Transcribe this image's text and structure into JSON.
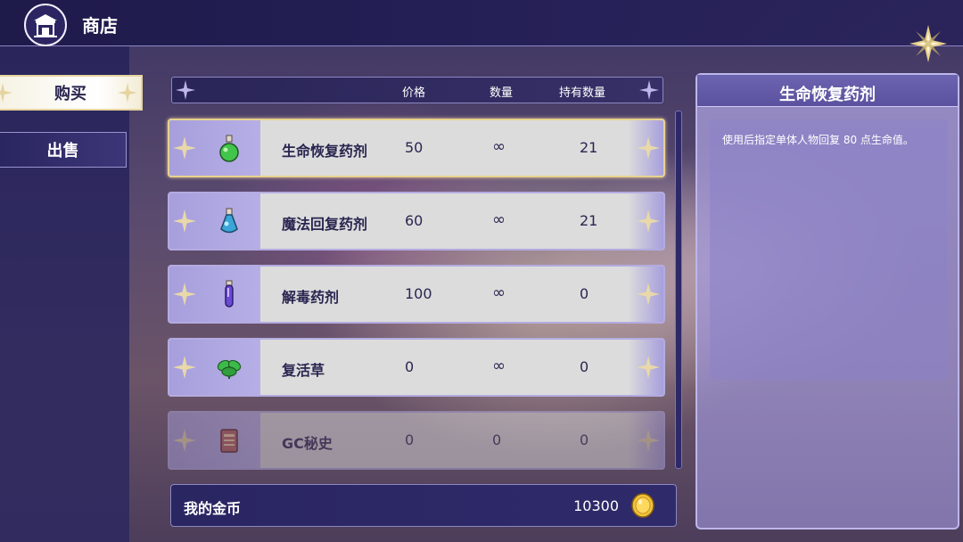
{
  "header": {
    "title": "商店",
    "logo_icon": "shop-icon",
    "corner_icon": "star-ornament-icon"
  },
  "sidebar": {
    "tabs": [
      {
        "label": "购买",
        "active": true
      },
      {
        "label": "出售",
        "active": false
      }
    ]
  },
  "table": {
    "columns": {
      "price": "价格",
      "quantity": "数量",
      "owned": "持有数量"
    },
    "rows": [
      {
        "name": "生命恢复药剂",
        "price": "50",
        "quantity": "∞",
        "owned": "21",
        "icon": "green-potion-icon",
        "selected": true,
        "disabled": false
      },
      {
        "name": "魔法回复药剂",
        "price": "60",
        "quantity": "∞",
        "owned": "21",
        "icon": "blue-potion-icon",
        "selected": false,
        "disabled": false
      },
      {
        "name": "解毒药剂",
        "price": "100",
        "quantity": "∞",
        "owned": "0",
        "icon": "purple-vial-icon",
        "selected": false,
        "disabled": false
      },
      {
        "name": "复活草",
        "price": "0",
        "quantity": "∞",
        "owned": "0",
        "icon": "herb-icon",
        "selected": false,
        "disabled": false
      },
      {
        "name": "GC秘史",
        "price": "0",
        "quantity": "0",
        "owned": "0",
        "icon": "book-icon",
        "selected": false,
        "disabled": true
      }
    ]
  },
  "wallet": {
    "label": "我的金币",
    "amount": "10300",
    "icon": "gold-coin-icon"
  },
  "detail": {
    "title": "生命恢复药剂",
    "description": "使用后指定单体人物回复 80 点生命值。"
  },
  "colors": {
    "accent_gold": "#e6d4a0",
    "panel_purple": "#a79fdc",
    "header_navy": "#1e1a4a"
  }
}
